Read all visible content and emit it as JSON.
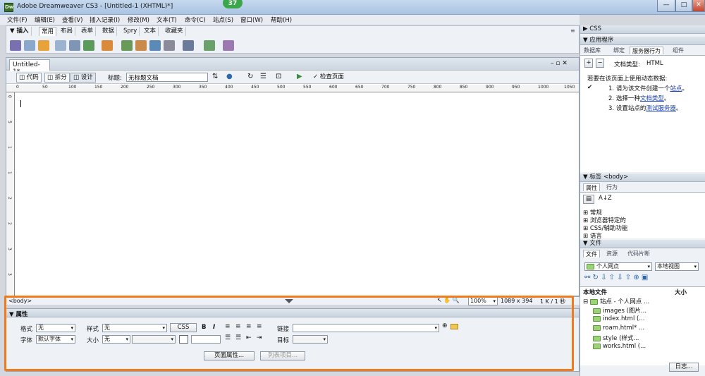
{
  "window": {
    "title": "Adobe Dreamweaver CS3 - [Untitled-1 (XHTML)*]",
    "logo": "Dw",
    "badge": "37",
    "min": "—",
    "max": "□",
    "close": "✕"
  },
  "menu": [
    "文件(F)",
    "编辑(E)",
    "查看(V)",
    "插入记录(I)",
    "修改(M)",
    "文本(T)",
    "命令(C)",
    "站点(S)",
    "窗口(W)",
    "帮助(H)"
  ],
  "insert_bar": {
    "label": "▼ 插入",
    "tabs": [
      "常用",
      "布局",
      "表单",
      "数据",
      "Spry",
      "文本",
      "收藏夹"
    ],
    "active": "常用"
  },
  "document": {
    "tab": "Untitled-1*",
    "views": [
      "代码",
      "拆分",
      "设计"
    ],
    "title_label": "标题:",
    "title_value": "无标题文档",
    "check_page": "检查页面",
    "ruler_top": [
      "0",
      "50",
      "100",
      "150",
      "200",
      "250",
      "300",
      "350",
      "400",
      "450",
      "500",
      "550",
      "600",
      "650",
      "700",
      "750",
      "800",
      "850",
      "900",
      "950",
      "1000",
      "1050"
    ],
    "ruler_left": [
      "0",
      "5",
      "1",
      "1",
      "2",
      "2",
      "3",
      "3"
    ]
  },
  "status": {
    "tag": "<body>",
    "zoom": "100%",
    "size": "1089 x 394",
    "weight": "1 K / 1 秒"
  },
  "properties": {
    "header": "▼ 属性",
    "format_label": "格式",
    "format_value": "无",
    "style_label": "样式",
    "style_value": "无",
    "css_button": "CSS",
    "bold": "B",
    "italic": "I",
    "link_label": "链接",
    "font_label": "字体",
    "font_value": "默认字体",
    "size_label": "大小",
    "size_value": "无",
    "target_label": "目标",
    "page_props_button": "页面属性...",
    "list_item_button": "列表项目..."
  },
  "right": {
    "css_header": "▶ CSS",
    "app_header": "▼ 应用程序",
    "app_tabs": [
      "数据库",
      "绑定",
      "服务器行为",
      "组件"
    ],
    "doc_type_label": "文档类型:",
    "doc_type_value": "HTML",
    "intro": "若要在该页面上使用动态数据:",
    "steps": [
      {
        "num": "1.",
        "text": "请为该文件创建一个",
        "link": "站点",
        "end": "。"
      },
      {
        "num": "2.",
        "text": "选择一种",
        "link": "文档类型",
        "end": "。"
      },
      {
        "num": "3.",
        "text": "设置站点的",
        "link": "测试服务器",
        "end": "。"
      }
    ],
    "tag_header": "▼ 标签 <body>",
    "tag_tabs": [
      "属性",
      "行为"
    ],
    "tag_groups": [
      "常规",
      "浏览器特定的",
      "CSS/辅助功能",
      "语言"
    ],
    "files_header": "▼ 文件",
    "files_tabs": [
      "文件",
      "资源",
      "代码片断"
    ],
    "site_select": "个人网点",
    "view_select": "本地视图",
    "files_col1": "本地文件",
    "files_col2": "大小",
    "files": [
      {
        "name": "站点 - 个人网点 ...",
        "level": 0
      },
      {
        "name": "images (图片...",
        "level": 1
      },
      {
        "name": "index.html (...",
        "level": 1
      },
      {
        "name": "roam.html* ...",
        "level": 1
      },
      {
        "name": "style (样式...",
        "level": 1
      },
      {
        "name": "works.html (...",
        "level": 1
      }
    ],
    "log_button": "日志..."
  }
}
